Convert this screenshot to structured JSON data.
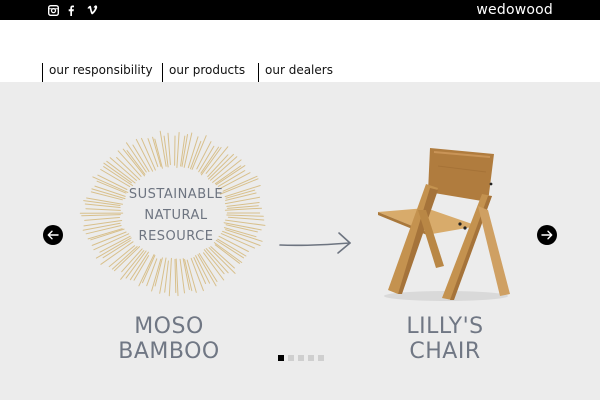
{
  "brand": {
    "logo_text": "wedowood"
  },
  "social": [
    {
      "icon": "instagram-icon"
    },
    {
      "icon": "facebook-icon"
    },
    {
      "icon": "vimeo-icon"
    }
  ],
  "nav": {
    "items": [
      {
        "label": "our responsibility"
      },
      {
        "label": "our products"
      },
      {
        "label": "our dealers"
      }
    ]
  },
  "slide": {
    "burst_lines": [
      "SUSTAINABLE",
      "NATURAL",
      "RESOURCE"
    ],
    "left_caption": "MOSO BAMBOO",
    "right_caption": "LILLY'S CHAIR"
  },
  "slider": {
    "total": 5,
    "active": 1
  },
  "colors": {
    "topbar": "#000000",
    "stage": "#ececec",
    "bamboo": "#d8c08c",
    "text_grey": "#6d7480"
  }
}
